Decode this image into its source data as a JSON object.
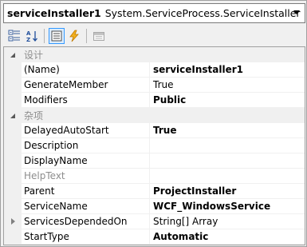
{
  "selector": {
    "object_name": "serviceInstaller1",
    "object_type": "System.ServiceProcess.ServiceInstaller"
  },
  "toolbar": {
    "buttons": [
      {
        "name": "categorized-icon",
        "active": false
      },
      {
        "name": "alphabetical-icon",
        "active": false
      },
      {
        "name": "properties-icon",
        "active": true
      },
      {
        "name": "events-icon",
        "active": false
      },
      {
        "name": "property-pages-icon",
        "active": false
      }
    ]
  },
  "grid": {
    "categories": [
      {
        "label": "设计",
        "rows": [
          {
            "name": "(Name)",
            "value": "serviceInstaller1",
            "bold": true
          },
          {
            "name": "GenerateMember",
            "value": "True",
            "bold": false
          },
          {
            "name": "Modifiers",
            "value": "Public",
            "bold": true
          }
        ]
      },
      {
        "label": "杂项",
        "rows": [
          {
            "name": "DelayedAutoStart",
            "value": "True",
            "bold": true
          },
          {
            "name": "Description",
            "value": "",
            "bold": false
          },
          {
            "name": "DisplayName",
            "value": "",
            "bold": false
          },
          {
            "name": "HelpText",
            "value": "",
            "bold": false,
            "disabled": true
          },
          {
            "name": "Parent",
            "value": "ProjectInstaller",
            "bold": true
          },
          {
            "name": "ServiceName",
            "value": "WCF_WindowsService",
            "bold": true
          },
          {
            "name": "ServicesDependedOn",
            "value": "String[] Array",
            "bold": false,
            "expandable": true
          },
          {
            "name": "StartType",
            "value": "Automatic",
            "bold": true
          }
        ]
      }
    ]
  }
}
